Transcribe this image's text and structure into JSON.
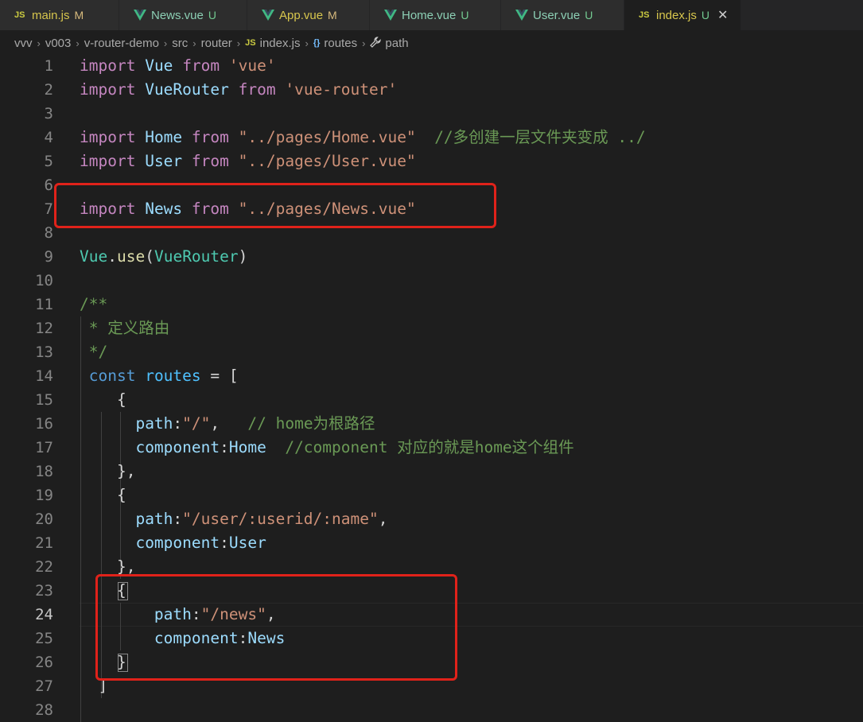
{
  "tabs": [
    {
      "icon": "JS",
      "name": "main.js",
      "status": "M"
    },
    {
      "icon": "vue",
      "name": "News.vue",
      "status": "U"
    },
    {
      "icon": "vue",
      "name": "App.vue",
      "status": "M"
    },
    {
      "icon": "vue",
      "name": "Home.vue",
      "status": "U"
    },
    {
      "icon": "vue",
      "name": "User.vue",
      "status": "U"
    },
    {
      "icon": "JS",
      "name": "index.js",
      "status": "U",
      "close": "✕"
    }
  ],
  "breadcrumb": {
    "items": [
      "vvv",
      "v003",
      "v-router-demo",
      "src",
      "router"
    ],
    "file_icon": "JS",
    "file": "index.js",
    "symbol_icon": "{}",
    "symbol": "routes",
    "key_icon": "🔧",
    "key": "path",
    "separator": "›"
  },
  "editor": {
    "line_numbers": [
      "1",
      "2",
      "3",
      "4",
      "5",
      "6",
      "7",
      "8",
      "9",
      "10",
      "11",
      "12",
      "13",
      "14",
      "15",
      "16",
      "17",
      "18",
      "19",
      "20",
      "21",
      "22",
      "23",
      "24",
      "25",
      "26",
      "27",
      "28"
    ],
    "current_line": "24",
    "code": {
      "l1": [
        "import",
        " ",
        "Vue",
        " ",
        "from",
        " ",
        "'vue'"
      ],
      "l2": [
        "import",
        " ",
        "VueRouter",
        " ",
        "from",
        " ",
        "'vue-router'"
      ],
      "l4": [
        "import",
        " ",
        "Home",
        " ",
        "from",
        " ",
        "\"../pages/Home.vue\"",
        "  ",
        "//多创建一层文件夹变成 ../"
      ],
      "l5": [
        "import",
        " ",
        "User",
        " ",
        "from",
        " ",
        "\"../pages/User.vue\""
      ],
      "l7": [
        "import",
        " ",
        "News",
        " ",
        "from",
        " ",
        "\"../pages/News.vue\""
      ],
      "l9": [
        "Vue",
        ".",
        "use",
        "(",
        "VueRouter",
        ")"
      ],
      "l11": "/**",
      "l12": " * 定义路由",
      "l13": " */",
      "l14": [
        " ",
        "const",
        " ",
        "routes",
        " = ["
      ],
      "l15": "    {",
      "l16": [
        "      ",
        "path",
        ":",
        "\"/\"",
        ",   ",
        "// home为根路径"
      ],
      "l17": [
        "      ",
        "component",
        ":",
        "Home",
        "  ",
        "//component 对应的就是home这个组件"
      ],
      "l18": "    },",
      "l19": "    {",
      "l20": [
        "      ",
        "path",
        ":",
        "\"/user/:userid/:name\"",
        ","
      ],
      "l21": [
        "      ",
        "component",
        ":",
        "User"
      ],
      "l22": "    },",
      "l23": "    {",
      "l24": [
        "        ",
        "path",
        ":",
        "\"/news\"",
        ","
      ],
      "l25": [
        "        ",
        "component",
        ":",
        "News"
      ],
      "l26": "    }",
      "l27": "  ]"
    }
  },
  "colors": {
    "background": "#1e1e1e",
    "keyword": "#c586c0",
    "string": "#ce9178",
    "comment": "#6a9955",
    "class": "#4ec9b0",
    "variable": "#9cdcfe",
    "highlight_box": "#e0221a"
  }
}
